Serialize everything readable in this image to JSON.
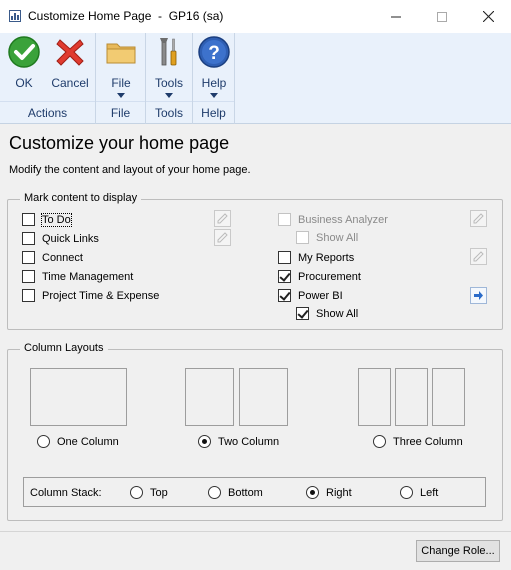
{
  "window": {
    "title": "Customize Home Page  -  GP16 (sa)"
  },
  "ribbon": {
    "groups": [
      {
        "label": "Actions",
        "buttons": [
          {
            "label": "OK"
          },
          {
            "label": "Cancel"
          }
        ]
      },
      {
        "label": "File",
        "buttons": [
          {
            "label": "File"
          }
        ]
      },
      {
        "label": "Tools",
        "buttons": [
          {
            "label": "Tools"
          }
        ]
      },
      {
        "label": "Help",
        "buttons": [
          {
            "label": "Help"
          }
        ]
      }
    ]
  },
  "page": {
    "heading": "Customize your home page",
    "subheading": "Modify the content and layout of your home page."
  },
  "content": {
    "group_title": "Mark content to display",
    "left_items": [
      {
        "label": "To Do",
        "checked": false
      },
      {
        "label": "Quick Links",
        "checked": false
      },
      {
        "label": "Connect",
        "checked": false
      },
      {
        "label": "Time Management",
        "checked": false
      },
      {
        "label": "Project Time & Expense",
        "checked": false
      }
    ],
    "right_items": [
      {
        "label": "Business Analyzer",
        "checked": false,
        "disabled": true
      },
      {
        "label": "Show All",
        "checked": false,
        "disabled": true
      },
      {
        "label": "My Reports",
        "checked": false
      },
      {
        "label": "Procurement",
        "checked": true
      },
      {
        "label": "Power BI",
        "checked": true
      },
      {
        "label": "Show All",
        "checked": true
      }
    ]
  },
  "layouts": {
    "group_title": "Column Layouts",
    "options": [
      {
        "label": "One Column",
        "selected": false
      },
      {
        "label": "Two Column",
        "selected": true
      },
      {
        "label": "Three Column",
        "selected": false
      }
    ],
    "stack_label": "Column Stack:",
    "stack_options": [
      {
        "label": "Top",
        "selected": false
      },
      {
        "label": "Bottom",
        "selected": false
      },
      {
        "label": "Right",
        "selected": true
      },
      {
        "label": "Left",
        "selected": false
      }
    ]
  },
  "footer": {
    "change_role_label": "Change Role..."
  },
  "colors": {
    "ribbon_bg": "#e9f1fb",
    "ribbon_text": "#1f3c6b",
    "window_bg": "#f0f0f0"
  }
}
